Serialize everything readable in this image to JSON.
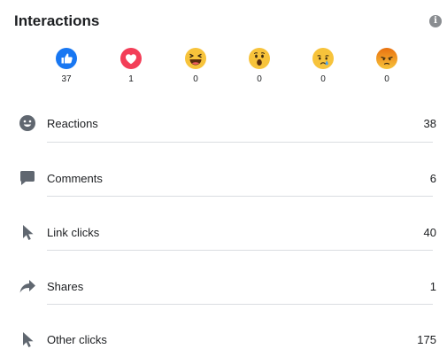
{
  "header": {
    "title": "Interactions"
  },
  "reactions": [
    {
      "name": "like",
      "count": "37"
    },
    {
      "name": "love",
      "count": "1"
    },
    {
      "name": "haha",
      "count": "0"
    },
    {
      "name": "wow",
      "count": "0"
    },
    {
      "name": "sad",
      "count": "0"
    },
    {
      "name": "angry",
      "count": "0"
    }
  ],
  "metrics": [
    {
      "label": "Reactions",
      "value": "38",
      "icon": "smiley-icon"
    },
    {
      "label": "Comments",
      "value": "6",
      "icon": "comment-bubble-icon"
    },
    {
      "label": "Link clicks",
      "value": "40",
      "icon": "cursor-arrow-icon"
    },
    {
      "label": "Shares",
      "value": "1",
      "icon": "share-arrow-icon"
    },
    {
      "label": "Other clicks",
      "value": "175",
      "icon": "cursor-arrow-icon"
    }
  ],
  "colors": {
    "like": "#1877f2",
    "love": "#f33e58",
    "emoji_yellow": "#f7c33b",
    "angry_top": "#e9710f",
    "icon_gray": "#606770",
    "divider": "#dadde1"
  }
}
